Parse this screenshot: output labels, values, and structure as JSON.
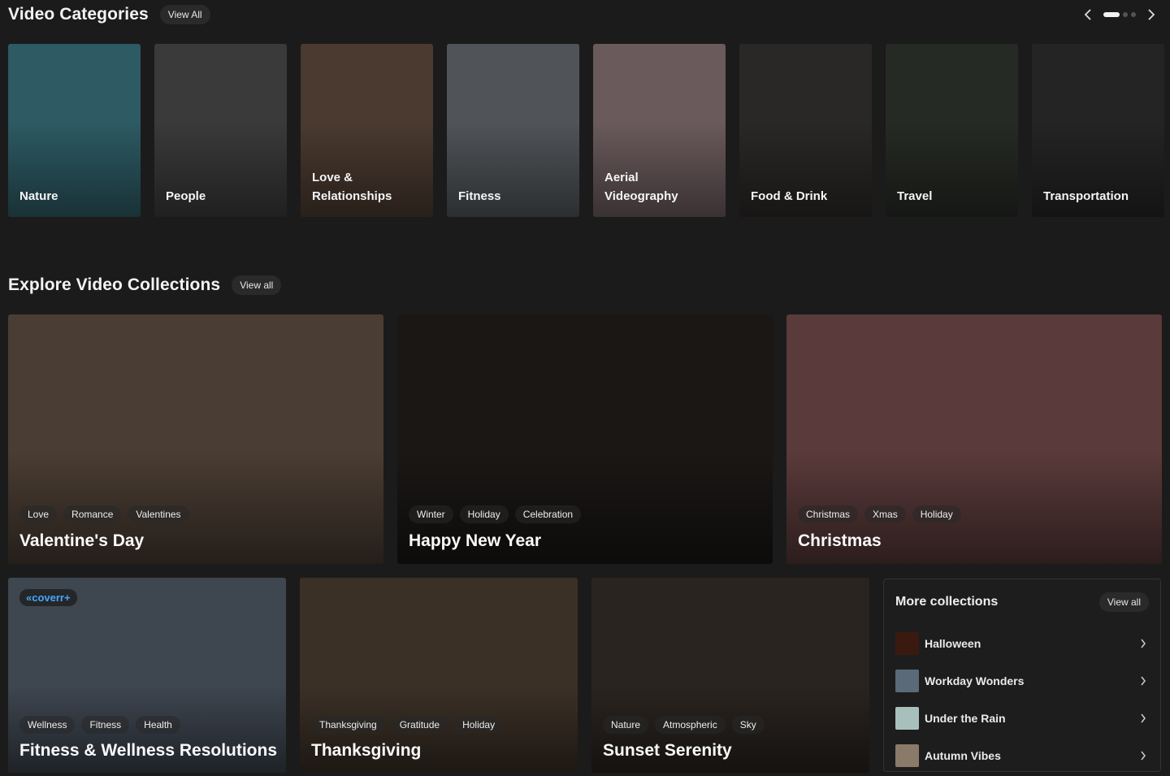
{
  "categories_section": {
    "title": "Video Categories",
    "view_all": "View All",
    "items": [
      {
        "label": "Nature",
        "bg": "#2d5a63"
      },
      {
        "label": "People",
        "bg": "#3a3a3a"
      },
      {
        "label": "Love &\nRelationships",
        "bg": "#4a3a30"
      },
      {
        "label": "Fitness",
        "bg": "#505458"
      },
      {
        "label": "Aerial\nVideography",
        "bg": "#6a5a5c"
      },
      {
        "label": "Food & Drink",
        "bg": "#2a2826"
      },
      {
        "label": "Travel",
        "bg": "#262a24"
      },
      {
        "label": "Transportation",
        "bg": "#242424"
      }
    ]
  },
  "collections_section": {
    "title": "Explore Video Collections",
    "view_all": "View all",
    "featured": [
      {
        "title": "Valentine's Day",
        "tags": [
          "Love",
          "Romance",
          "Valentines"
        ],
        "bg": "#4a3d33"
      },
      {
        "title": "Happy New Year",
        "tags": [
          "Winter",
          "Holiday",
          "Celebration"
        ],
        "bg": "#1a1715"
      },
      {
        "title": "Christmas",
        "tags": [
          "Christmas",
          "Xmas",
          "Holiday"
        ],
        "bg": "#5a3a3a"
      }
    ],
    "secondary": [
      {
        "title": "Fitness & Wellness Resolutions",
        "tags": [
          "Wellness",
          "Fitness",
          "Health"
        ],
        "bg": "#3e4650",
        "badge": "«coverr+"
      },
      {
        "title": "Thanksgiving",
        "tags": [
          "Thanksgiving",
          "Gratitude",
          "Holiday"
        ],
        "bg": "#3b3026"
      },
      {
        "title": "Sunset Serenity",
        "tags": [
          "Nature",
          "Atmospheric",
          "Sky"
        ],
        "bg": "#2a2420"
      }
    ]
  },
  "more_collections": {
    "title": "More collections",
    "view_all": "View all",
    "items": [
      {
        "label": "Halloween",
        "thumb": "#3a1a10"
      },
      {
        "label": "Workday Wonders",
        "thumb": "#5a6a78"
      },
      {
        "label": "Under the Rain",
        "thumb": "#a8c0bc"
      },
      {
        "label": "Autumn Vibes",
        "thumb": "#8a7a6a"
      }
    ]
  },
  "icons": {
    "prev": "chevron-left-icon",
    "next": "chevron-right-icon",
    "row_arrow": "chevron-right-icon"
  }
}
